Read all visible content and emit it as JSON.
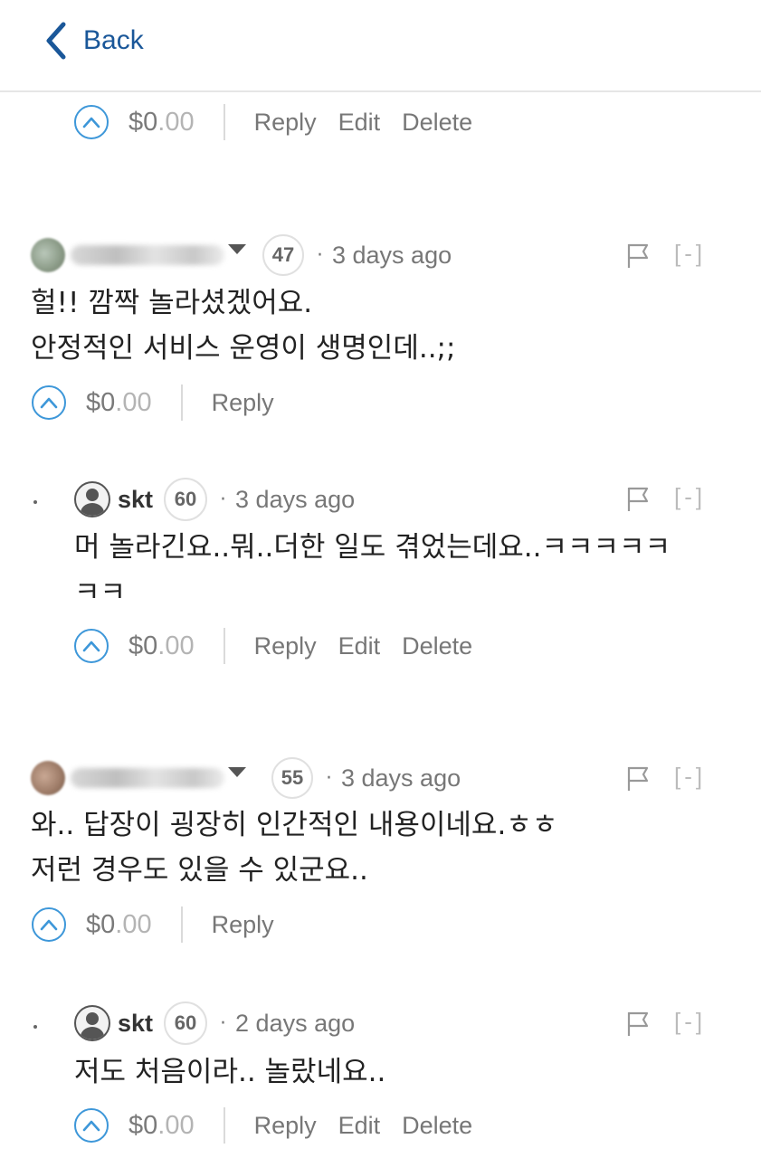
{
  "header": {
    "back_label": "Back"
  },
  "top_actions": {
    "payout_int": "$0",
    "payout_cents": ".00",
    "reply": "Reply",
    "edit": "Edit",
    "delete": "Delete"
  },
  "comments": [
    {
      "reputation": "47",
      "time": "3 days ago",
      "collapse": "[-]",
      "lines": [
        "헐!! 깜짝 놀라셨겠어요.",
        "안정적인 서비스 운영이 생명인데..;;"
      ],
      "payout_int": "$0",
      "payout_cents": ".00",
      "reply": "Reply",
      "reply_comment": {
        "author": "skt",
        "reputation": "60",
        "time": "3 days ago",
        "collapse": "[-]",
        "lines": [
          "머 놀라긴요..뭐..더한 일도 겪었는데요..ㅋㅋㅋㅋㅋ",
          "ㅋㅋ"
        ],
        "payout_int": "$0",
        "payout_cents": ".00",
        "reply": "Reply",
        "edit": "Edit",
        "delete": "Delete"
      }
    },
    {
      "reputation": "55",
      "time": "3 days ago",
      "collapse": "[-]",
      "lines": [
        "와.. 답장이 굉장히 인간적인 내용이네요.ㅎㅎ",
        "저런 경우도 있을 수 있군요.."
      ],
      "payout_int": "$0",
      "payout_cents": ".00",
      "reply": "Reply",
      "reply_comment": {
        "author": "skt",
        "reputation": "60",
        "time": "2 days ago",
        "collapse": "[-]",
        "lines": [
          "저도 처음이라.. 놀랐네요.."
        ],
        "payout_int": "$0",
        "payout_cents": ".00",
        "reply": "Reply",
        "edit": "Edit",
        "delete": "Delete"
      }
    }
  ],
  "icons": {
    "back": "chevron-left-icon",
    "upvote": "chevron-up-icon",
    "flag": "flag-icon",
    "avatar": "user-silhouette-icon"
  },
  "colors": {
    "accent": "#1a5799",
    "upvote": "#3d97d9"
  }
}
